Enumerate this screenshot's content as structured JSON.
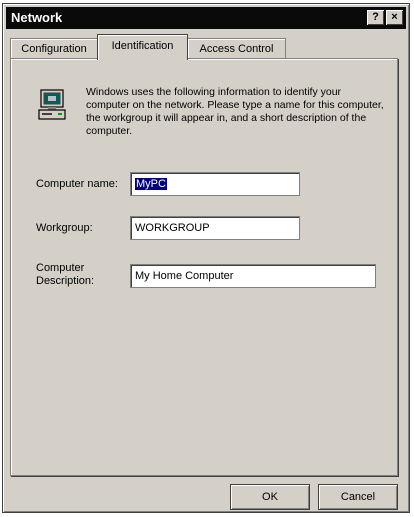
{
  "window": {
    "title": "Network",
    "help_label": "?",
    "close_label": "×"
  },
  "tabs": [
    {
      "label": "Configuration",
      "active": false
    },
    {
      "label": "Identification",
      "active": true
    },
    {
      "label": "Access Control",
      "active": false
    }
  ],
  "info_text": "Windows uses the following information to identify your computer on the network.  Please type a name for this computer, the workgroup it will appear in, and a short description of the computer.",
  "fields": {
    "computer_name": {
      "label": "Computer name:",
      "value": "MyPC"
    },
    "workgroup": {
      "label": "Workgroup:",
      "value": "WORKGROUP"
    },
    "description": {
      "label_line1": "Computer",
      "label_line2": "Description:",
      "value": "My Home Computer"
    }
  },
  "buttons": {
    "ok": "OK",
    "cancel": "Cancel"
  },
  "icons": {
    "computer": "computer-icon"
  },
  "colors": {
    "selection": "#000080",
    "face": "#d4d0c8",
    "titlebar": "#0a0a0a"
  }
}
